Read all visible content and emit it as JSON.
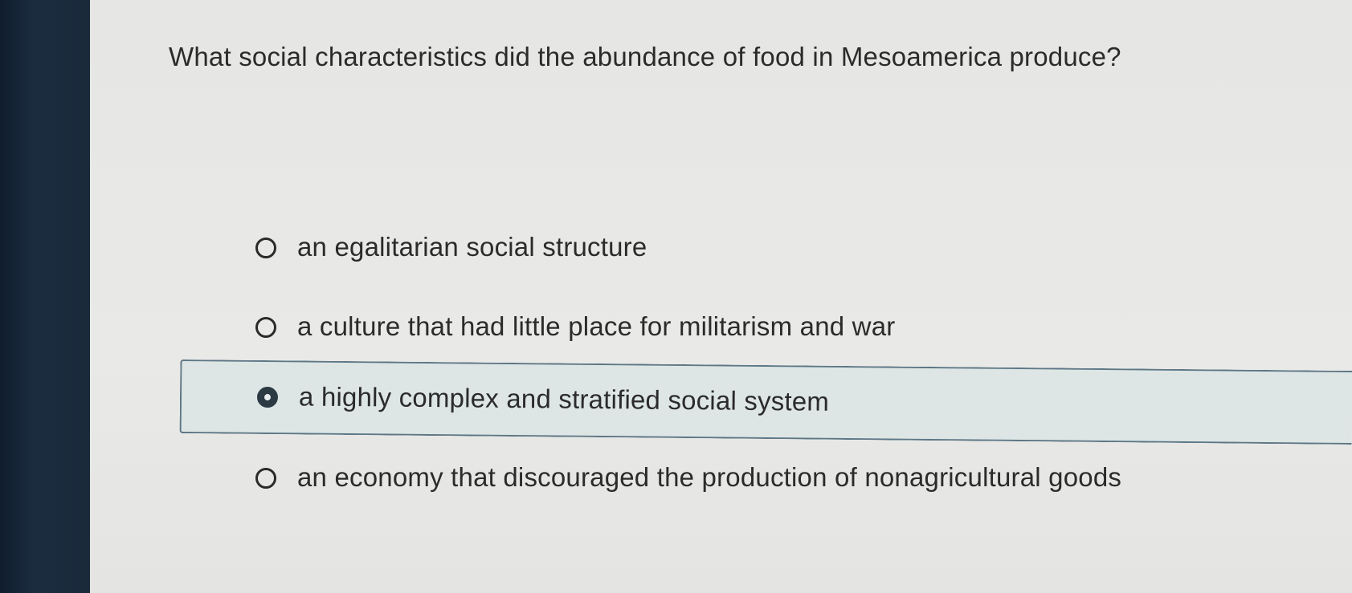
{
  "question": {
    "text": "What social characteristics did the abundance of food in Mesoamerica produce?"
  },
  "choices": [
    {
      "label": "an egalitarian social structure",
      "selected": false
    },
    {
      "label": "a culture that had little place for militarism and war",
      "selected": false
    },
    {
      "label": "a highly complex and stratified social system",
      "selected": true
    },
    {
      "label": "an economy that discouraged the production of nonagricultural goods",
      "selected": false
    }
  ],
  "colors": {
    "page_background": "#e6e6e4",
    "bezel": "#1b2c3f",
    "selected_background": "#dde6e5",
    "selected_border": "#5d7785",
    "text": "#2b2b2b",
    "radio_checked": "#2c3a44"
  }
}
